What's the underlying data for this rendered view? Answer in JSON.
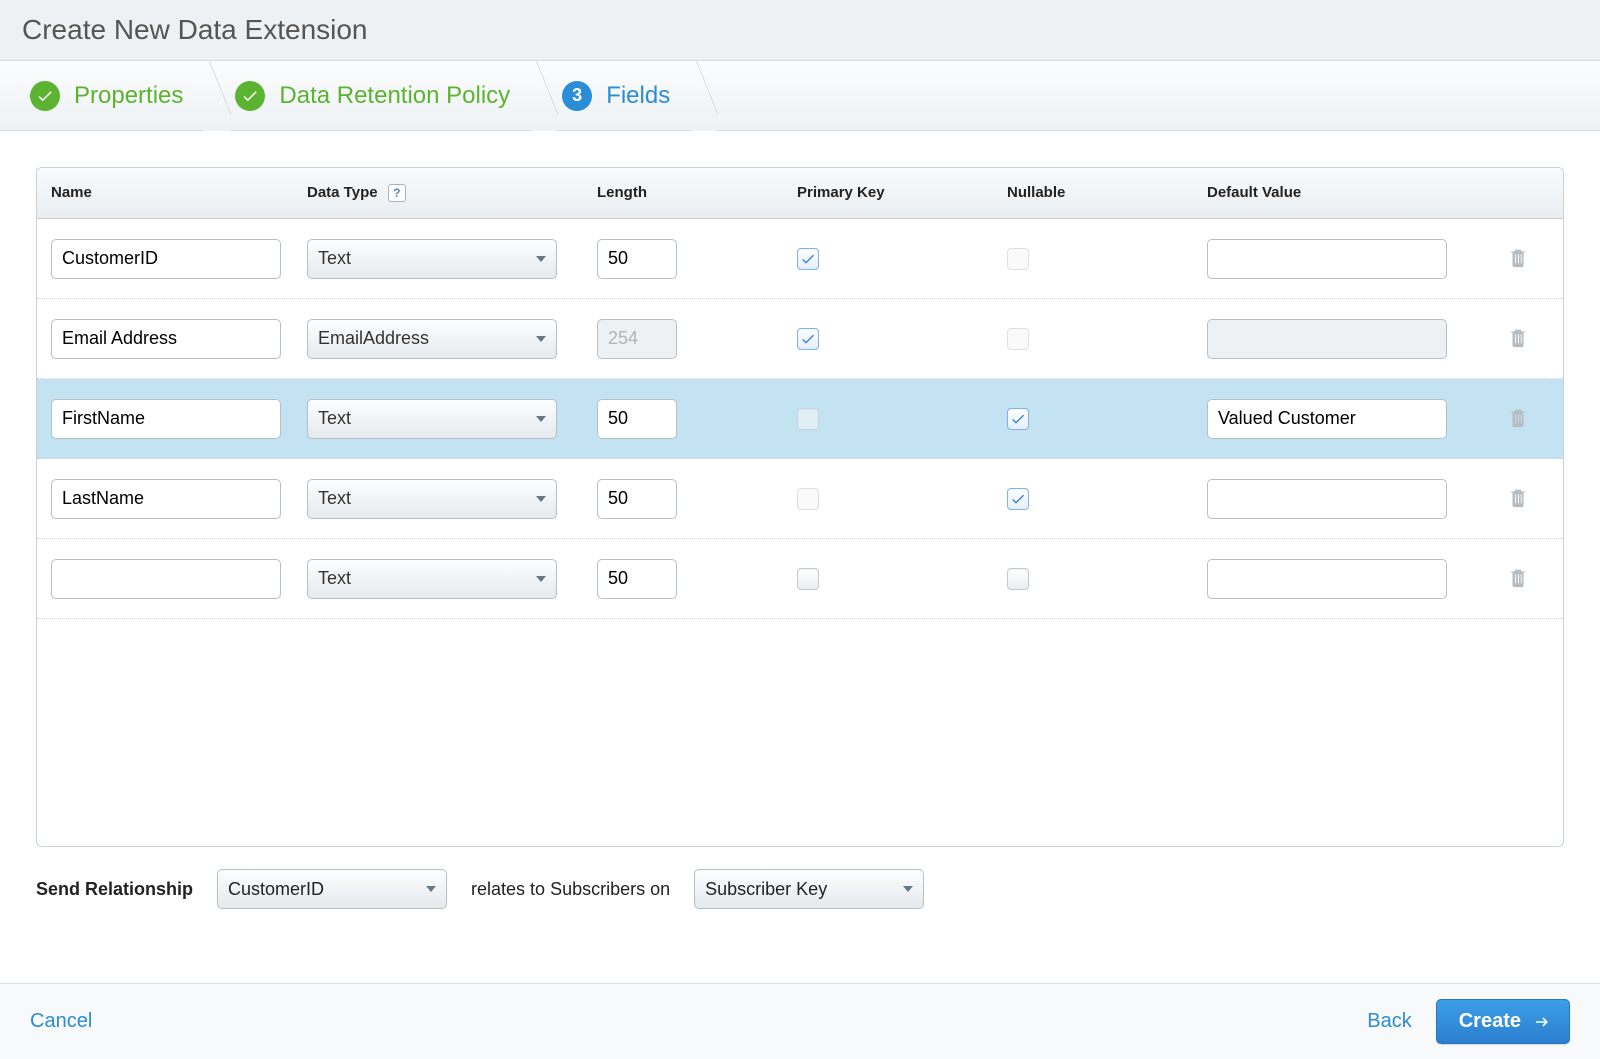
{
  "title": "Create New Data Extension",
  "wizard": {
    "steps": [
      {
        "label": "Properties",
        "state": "done"
      },
      {
        "label": "Data Retention Policy",
        "state": "done"
      },
      {
        "label": "Fields",
        "state": "active",
        "number": "3"
      }
    ]
  },
  "columns": {
    "name": "Name",
    "data_type": "Data Type",
    "length": "Length",
    "primary_key": "Primary Key",
    "nullable": "Nullable",
    "default_value": "Default Value"
  },
  "rows": [
    {
      "name": "CustomerID",
      "type": "Text",
      "length": "50",
      "length_disabled": false,
      "pk": true,
      "pk_dim": false,
      "nullable": false,
      "nullable_dim": true,
      "default": "",
      "default_disabled": false,
      "selected": false
    },
    {
      "name": "Email Address",
      "type": "EmailAddress",
      "length": "254",
      "length_disabled": true,
      "pk": true,
      "pk_dim": false,
      "nullable": false,
      "nullable_dim": true,
      "default": "",
      "default_disabled": true,
      "selected": false
    },
    {
      "name": "FirstName",
      "type": "Text",
      "length": "50",
      "length_disabled": false,
      "pk": false,
      "pk_dim": true,
      "nullable": true,
      "nullable_dim": false,
      "default": "Valued Customer",
      "default_disabled": false,
      "selected": true
    },
    {
      "name": "LastName",
      "type": "Text",
      "length": "50",
      "length_disabled": false,
      "pk": false,
      "pk_dim": true,
      "nullable": true,
      "nullable_dim": false,
      "default": "",
      "default_disabled": false,
      "selected": false
    },
    {
      "name": "",
      "type": "Text",
      "length": "50",
      "length_disabled": false,
      "pk": false,
      "pk_dim": false,
      "nullable": false,
      "nullable_dim": false,
      "default": "",
      "default_disabled": false,
      "selected": false
    }
  ],
  "send_relationship": {
    "label": "Send Relationship",
    "left_select": "CustomerID",
    "middle_text": "relates to Subscribers on",
    "right_select": "Subscriber Key"
  },
  "footer": {
    "cancel": "Cancel",
    "back": "Back",
    "create": "Create"
  }
}
